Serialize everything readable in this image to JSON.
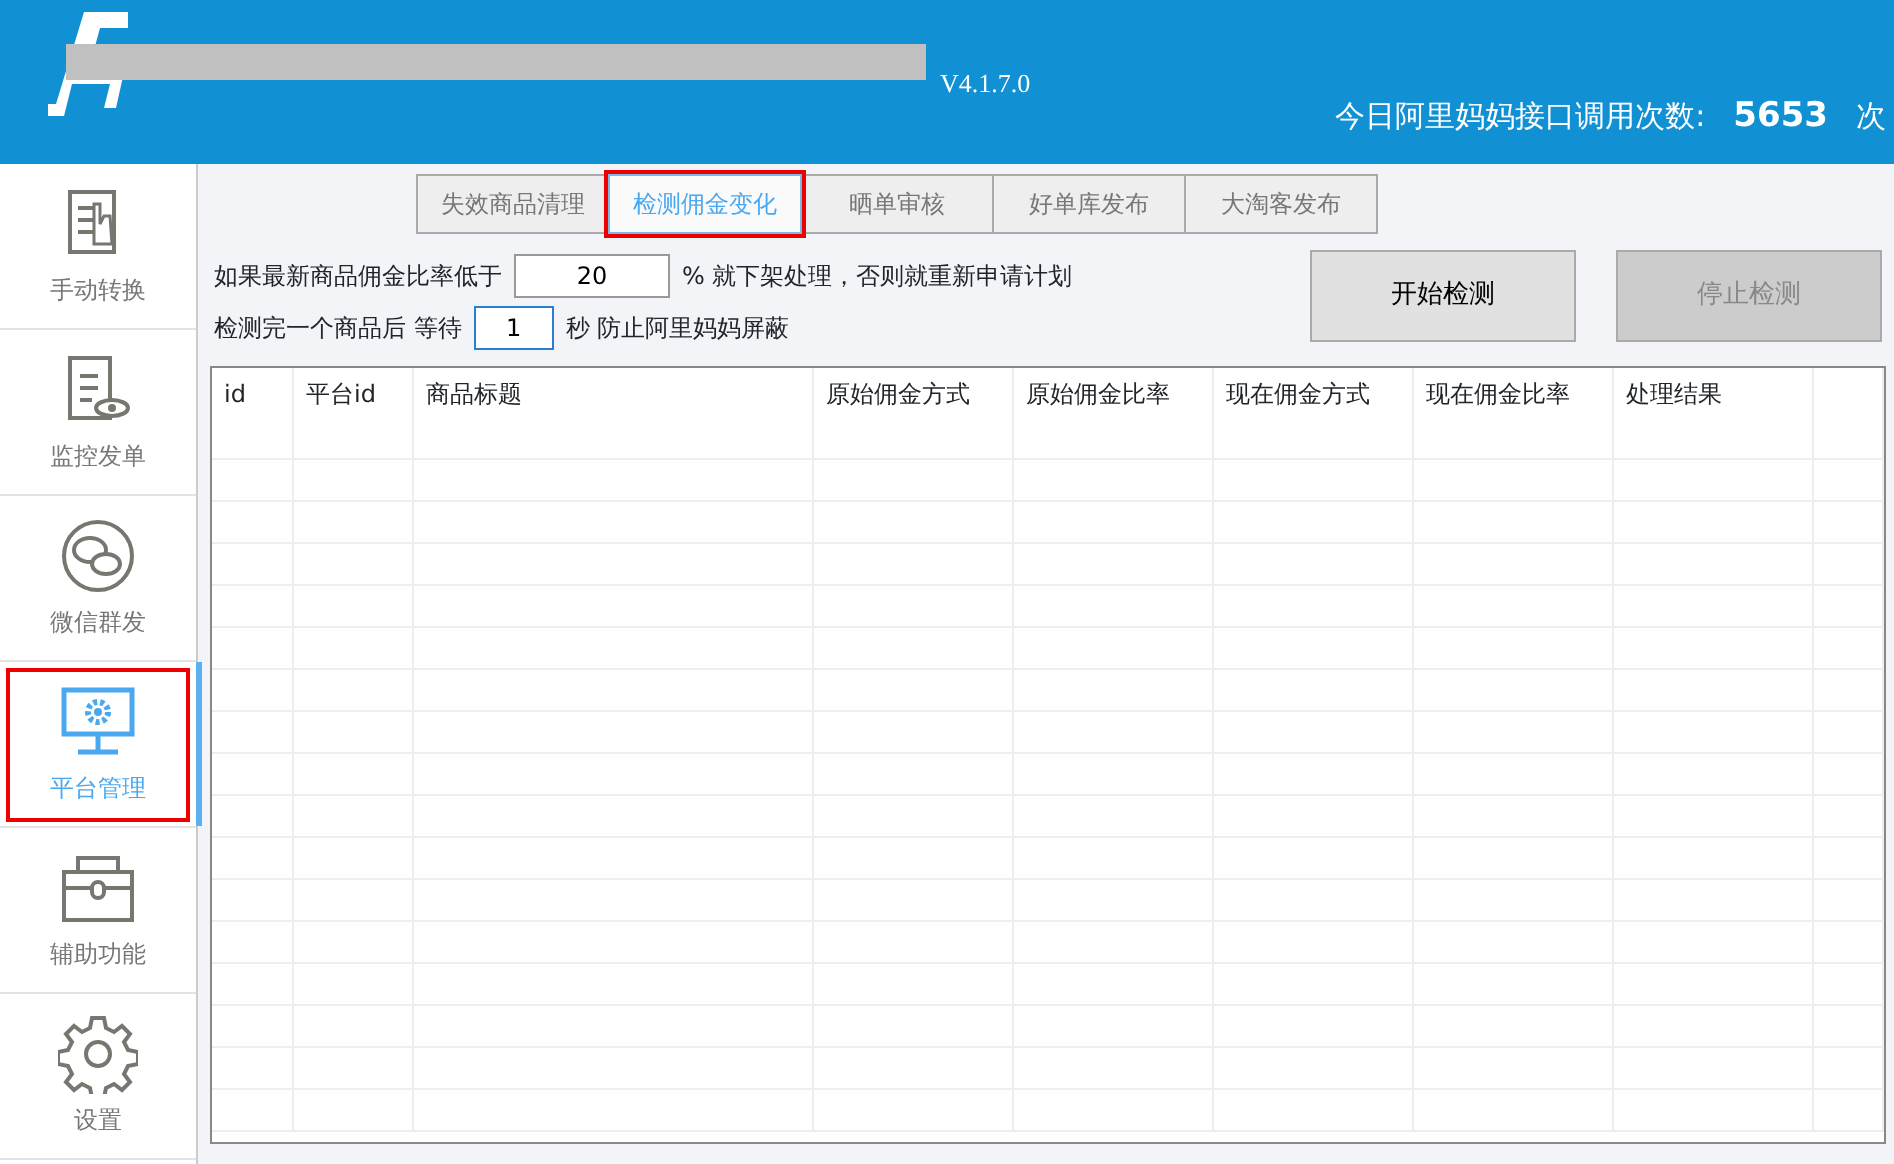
{
  "header": {
    "version": "V4.1.7.0",
    "counter_label": "今日阿里妈妈接口调用次数:",
    "counter_value": "5653",
    "counter_unit": "次"
  },
  "sidebar": {
    "items": [
      {
        "label": "手动转换",
        "selected": false,
        "highlighted": false
      },
      {
        "label": "监控发单",
        "selected": false,
        "highlighted": false
      },
      {
        "label": "微信群发",
        "selected": false,
        "highlighted": false
      },
      {
        "label": "平台管理",
        "selected": true,
        "highlighted": true
      },
      {
        "label": "辅助功能",
        "selected": false,
        "highlighted": false
      },
      {
        "label": "设置",
        "selected": false,
        "highlighted": false
      }
    ]
  },
  "tabs": [
    {
      "label": "失效商品清理",
      "selected": false,
      "highlighted": false
    },
    {
      "label": "检测佣金变化",
      "selected": true,
      "highlighted": true
    },
    {
      "label": "晒单审核",
      "selected": false,
      "highlighted": false
    },
    {
      "label": "好单库发布",
      "selected": false,
      "highlighted": false
    },
    {
      "label": "大淘客发布",
      "selected": false,
      "highlighted": false
    }
  ],
  "form": {
    "rows": [
      {
        "before": "如果最新商品佣金比率低于",
        "value": "20",
        "after": "% 就下架处理，否则就重新申请计划",
        "focused": false
      },
      {
        "before": "检测完一个商品后 等待",
        "value": "1",
        "after": "秒 防止阿里妈妈屏蔽",
        "focused": true
      }
    ],
    "buttons": [
      {
        "label": "开始检测",
        "disabled": false
      },
      {
        "label": "停止检测",
        "disabled": true
      }
    ]
  },
  "table": {
    "columns": [
      "id",
      "平台id",
      "商品标题",
      "原始佣金方式",
      "原始佣金比率",
      "现在佣金方式",
      "现在佣金比率",
      "处理结果"
    ]
  }
}
